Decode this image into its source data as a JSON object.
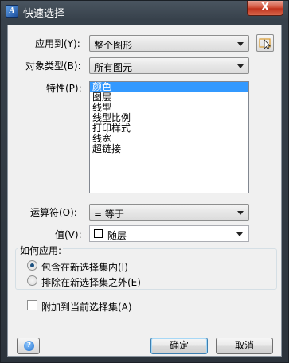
{
  "window": {
    "title": "快速选择",
    "close_glyph": "X"
  },
  "form": {
    "apply_to_label": "应用到(Y):",
    "apply_to_value": "整个图形",
    "object_type_label": "对象类型(B):",
    "object_type_value": "所有图元",
    "properties_label": "特性(P):",
    "properties": [
      "颜色",
      "图层",
      "线型",
      "线型比例",
      "打印样式",
      "线宽",
      "超链接"
    ],
    "selected_property_index": 0,
    "operator_label": "运算符(O):",
    "operator_value": "= 等于",
    "value_label": "值(V):",
    "value_value": "随层"
  },
  "how_to_apply": {
    "title": "如何应用:",
    "include_label": "包含在新选择集内(I)",
    "exclude_label": "排除在新选择集之外(E)",
    "selected": "include"
  },
  "append": {
    "label": "附加到当前选择集(A)",
    "checked": false
  },
  "buttons": {
    "help_glyph": "?",
    "ok_label": "确定",
    "cancel_label": "取消"
  },
  "icons": {
    "app": "quick-select-app-icon",
    "select_objects": "select-objects-icon",
    "help": "help-icon"
  }
}
